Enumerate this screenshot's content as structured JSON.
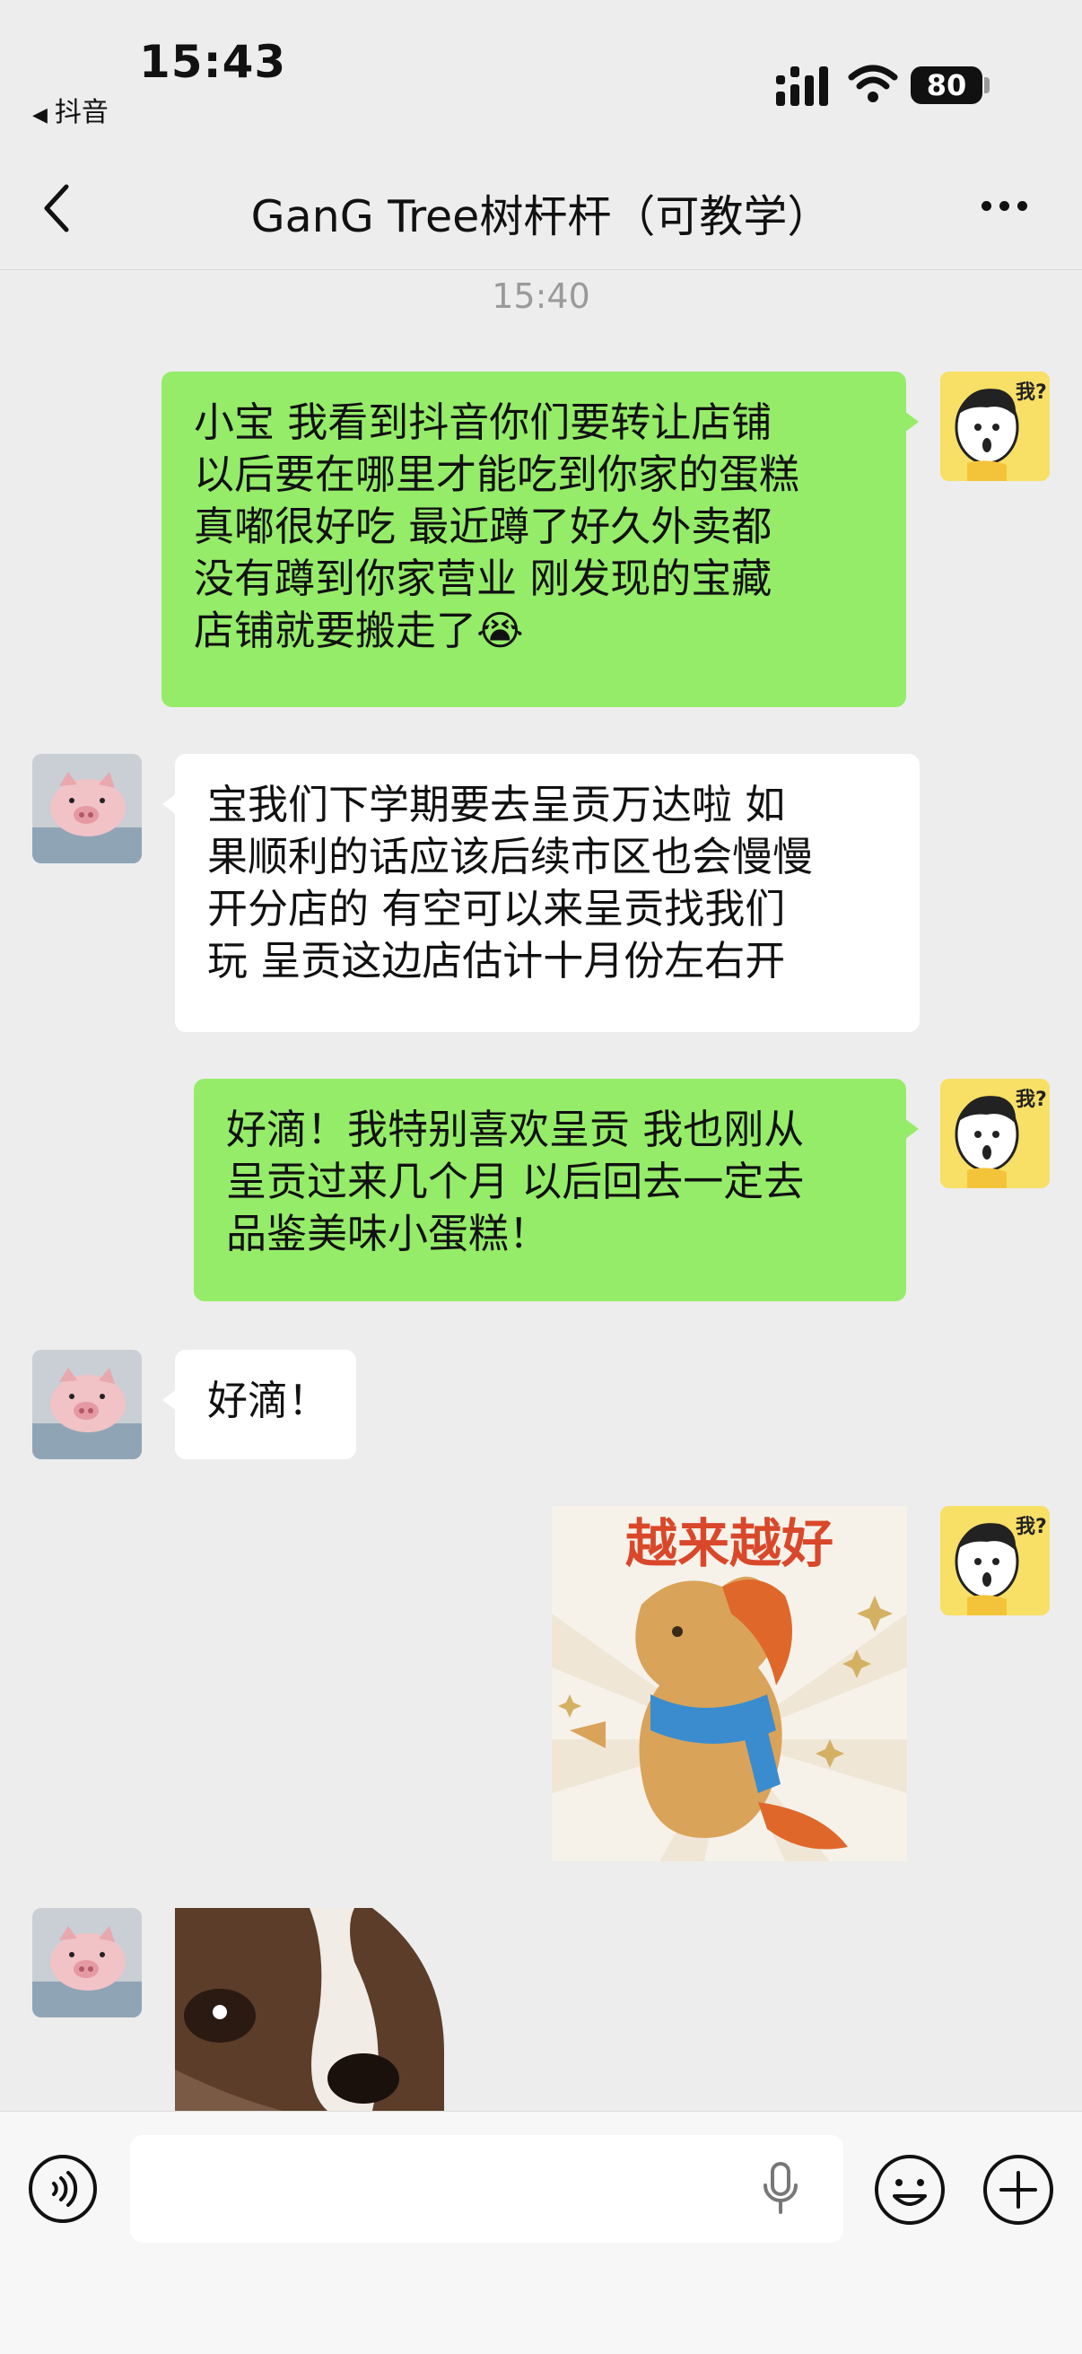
{
  "status_bar": {
    "time": "15:43",
    "back_app": "抖音",
    "battery": "80"
  },
  "nav": {
    "title": "GanG Tree树杆杆（可教学）"
  },
  "chat": {
    "timestamp": "15:40",
    "messages": [
      {
        "sender": "me",
        "lines": [
          "小宝 我看到抖音你们要转让店铺",
          "以后要在哪里才能吃到你家的蛋糕",
          "真嘟很好吃 最近蹲了好久外卖都",
          "没有蹲到你家营业 刚发现的宝藏",
          "店铺就要搬走了"
        ],
        "trailing_emoji": "😭"
      },
      {
        "sender": "other",
        "lines": [
          "宝我们下学期要去呈贡万达啦  如",
          "果顺利的话应该后续市区也会慢慢",
          "开分店的 有空可以来呈贡找我们",
          "玩  呈贡这边店估计十月份左右开"
        ]
      },
      {
        "sender": "me",
        "lines": [
          "好滴！我特别喜欢呈贡 我也刚从",
          "呈贡过来几个月 以后回去一定去",
          "品鉴美味小蛋糕！"
        ]
      },
      {
        "sender": "other",
        "lines": [
          "好滴！"
        ]
      },
      {
        "sender": "me",
        "sticker_text": "越来越好"
      },
      {
        "sender": "other",
        "sticker": "dog-face"
      }
    ]
  },
  "colors": {
    "my_bubble": "#95ec69",
    "other_bubble": "#ffffff",
    "background": "#ededed"
  }
}
